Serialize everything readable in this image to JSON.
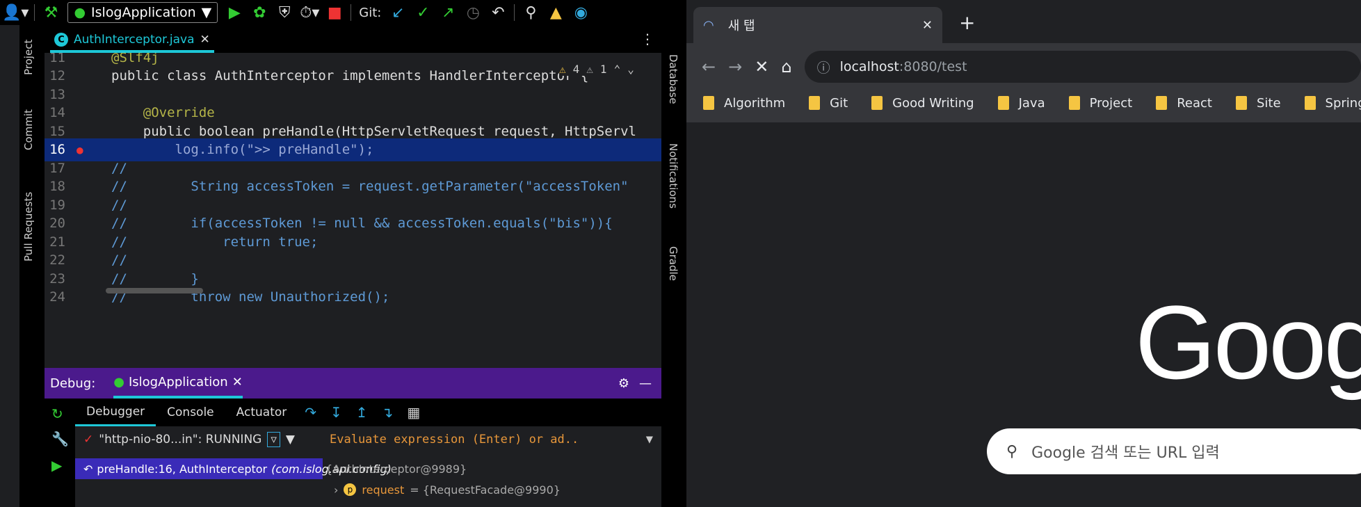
{
  "ide": {
    "run_config": "IslogApplication",
    "git_label": "Git:",
    "editor_tab": "AuthInterceptor.java",
    "left_tools": [
      "Project",
      "Commit",
      "Pull Requests"
    ],
    "right_tools": [
      "Database",
      "Notifications",
      "Gradle"
    ],
    "warnings_count": "4",
    "weak_warnings_count": "1",
    "code_lines": [
      {
        "no": "11",
        "text": "@Slf4j"
      },
      {
        "no": "12",
        "text": "public class AuthInterceptor implements HandlerInterceptor {"
      },
      {
        "no": "13",
        "text": ""
      },
      {
        "no": "14",
        "text": "    @Override"
      },
      {
        "no": "15",
        "text": "    public boolean preHandle(HttpServletRequest request, HttpServl"
      },
      {
        "no": "16",
        "text": "        log.info(\">> preHandle\");"
      },
      {
        "no": "17",
        "text": "//"
      },
      {
        "no": "18",
        "text": "//        String accessToken = request.getParameter(\"accessToken\""
      },
      {
        "no": "19",
        "text": "//"
      },
      {
        "no": "20",
        "text": "//        if(accessToken != null && accessToken.equals(\"bis\")){"
      },
      {
        "no": "21",
        "text": "//            return true;"
      },
      {
        "no": "22",
        "text": "//"
      },
      {
        "no": "23",
        "text": "//        }"
      },
      {
        "no": "24",
        "text": "//        throw new Unauthorized();"
      }
    ],
    "debug": {
      "label": "Debug:",
      "session": "IslogApplication",
      "tabs": [
        "Debugger",
        "Console",
        "Actuator"
      ],
      "thread": "\"http-nio-80...in\": RUNNING",
      "eval_placeholder": "Evaluate expression (Enter) or ad..",
      "frame_method": "preHandle:16, AuthInterceptor",
      "frame_package": "(com.islog.api.config)",
      "this_value": "{AuthInterceptor@9989}",
      "var_name": "request",
      "var_value": "= {RequestFacade@9990}"
    }
  },
  "browser": {
    "tab_title": "새 탭",
    "url_host": "localhost",
    "url_rest": ":8080/test",
    "bookmarks": [
      "Algorithm",
      "Git",
      "Good Writing",
      "Java",
      "Project",
      "React",
      "Site",
      "Spring"
    ],
    "logo_text": "Goog",
    "search_placeholder": "Google 검색 또는 URL 입력"
  }
}
